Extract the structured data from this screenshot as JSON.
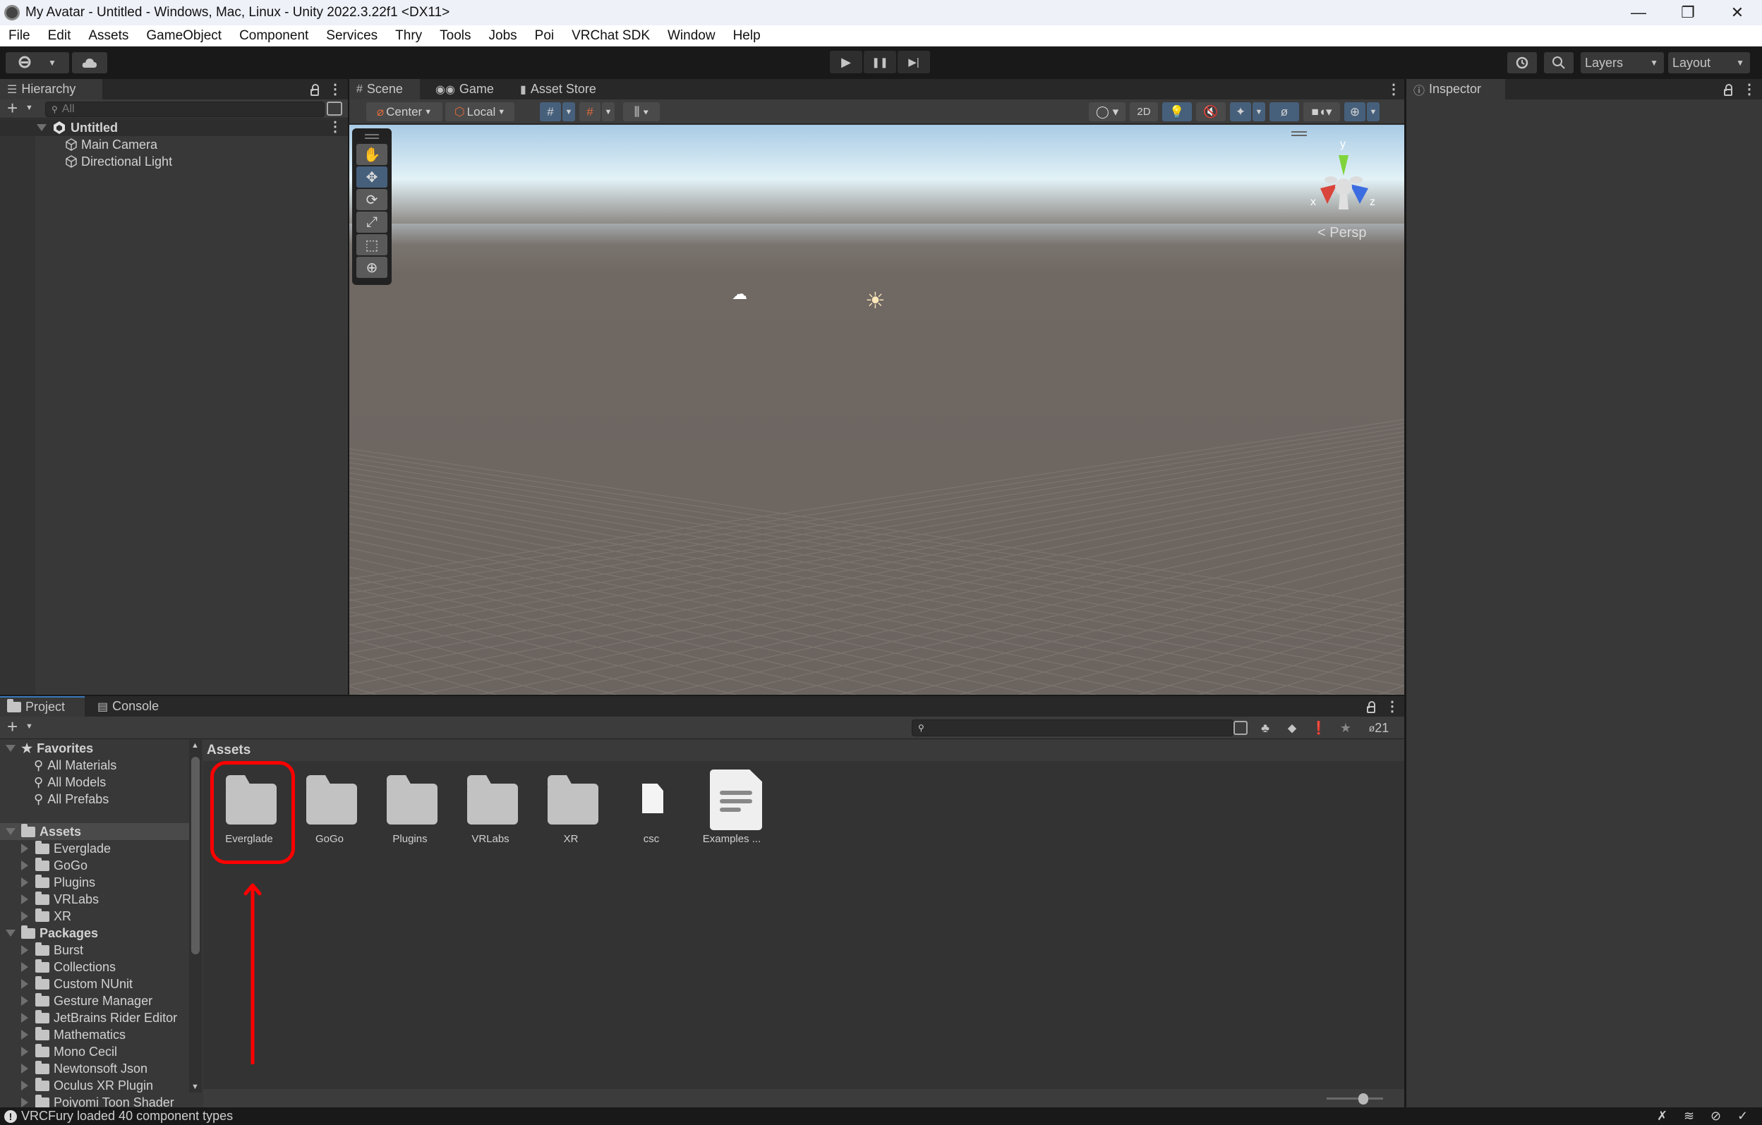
{
  "window": {
    "title": "My Avatar - Untitled - Windows, Mac, Linux - Unity 2022.3.22f1 <DX11>",
    "controls": {
      "minimize": "—",
      "maximize": "❐",
      "close": "✕"
    }
  },
  "menu": [
    "File",
    "Edit",
    "Assets",
    "GameObject",
    "Component",
    "Services",
    "Thry",
    "Tools",
    "Jobs",
    "Poi",
    "VRChat SDK",
    "Window",
    "Help"
  ],
  "toolbar": {
    "account_icon": "account-icon",
    "cloud_icon": "cloud-icon",
    "play": "▶",
    "pause": "❚❚",
    "step": "▶|",
    "history_icon": "history-icon",
    "search_icon": "search-icon",
    "layers_label": "Layers",
    "layout_label": "Layout"
  },
  "hierarchy": {
    "tab_label": "Hierarchy",
    "search_placeholder": "All",
    "scene_name": "Untitled",
    "items": [
      "Main Camera",
      "Directional Light"
    ]
  },
  "scene_tabs": [
    {
      "label": "Scene",
      "icon": "#",
      "active": true
    },
    {
      "label": "Game",
      "icon": "game-controller-icon",
      "active": false
    },
    {
      "label": "Asset Store",
      "icon": "shopping-bag-icon",
      "active": false
    }
  ],
  "scene_toolbar": {
    "pivot_mode": "Center",
    "pivot_rotation": "Local",
    "toggle_2d": "2D"
  },
  "scene_view": {
    "projection_label": "Persp",
    "gizmo_axes": {
      "x": "x",
      "y": "y",
      "z": "z"
    },
    "axis_colors": {
      "x": "#d9453b",
      "y": "#7fd43b",
      "z": "#3c6de0"
    }
  },
  "inspector": {
    "tab_label": "Inspector"
  },
  "project": {
    "tabs": [
      {
        "label": "Project",
        "active": true
      },
      {
        "label": "Console",
        "active": false
      }
    ],
    "favorites_label": "Favorites",
    "favorites": [
      "All Materials",
      "All Models",
      "All Prefabs"
    ],
    "assets_label": "Assets",
    "assets_tree": [
      "Everglade",
      "GoGo",
      "Plugins",
      "VRLabs",
      "XR"
    ],
    "packages_label": "Packages",
    "packages": [
      "Burst",
      "Collections",
      "Custom NUnit",
      "Gesture Manager",
      "JetBrains Rider Editor",
      "Mathematics",
      "Mono Cecil",
      "Newtonsoft Json",
      "Oculus XR Plugin",
      "Poiyomi Toon Shader"
    ],
    "breadcrumb": "Assets",
    "grid_items": [
      {
        "name": "Everglade",
        "type": "folder",
        "highlighted": true
      },
      {
        "name": "GoGo",
        "type": "folder"
      },
      {
        "name": "Plugins",
        "type": "folder"
      },
      {
        "name": "VRLabs",
        "type": "folder"
      },
      {
        "name": "XR",
        "type": "folder"
      },
      {
        "name": "csc",
        "type": "file"
      },
      {
        "name": "Examples ...",
        "type": "document"
      }
    ],
    "hidden_count": "21",
    "zoom_slider_value": 0.65
  },
  "status": {
    "message": "VRCFury loaded 40 component types"
  },
  "annotation": {
    "color": "#ff0000",
    "target": "Everglade"
  }
}
